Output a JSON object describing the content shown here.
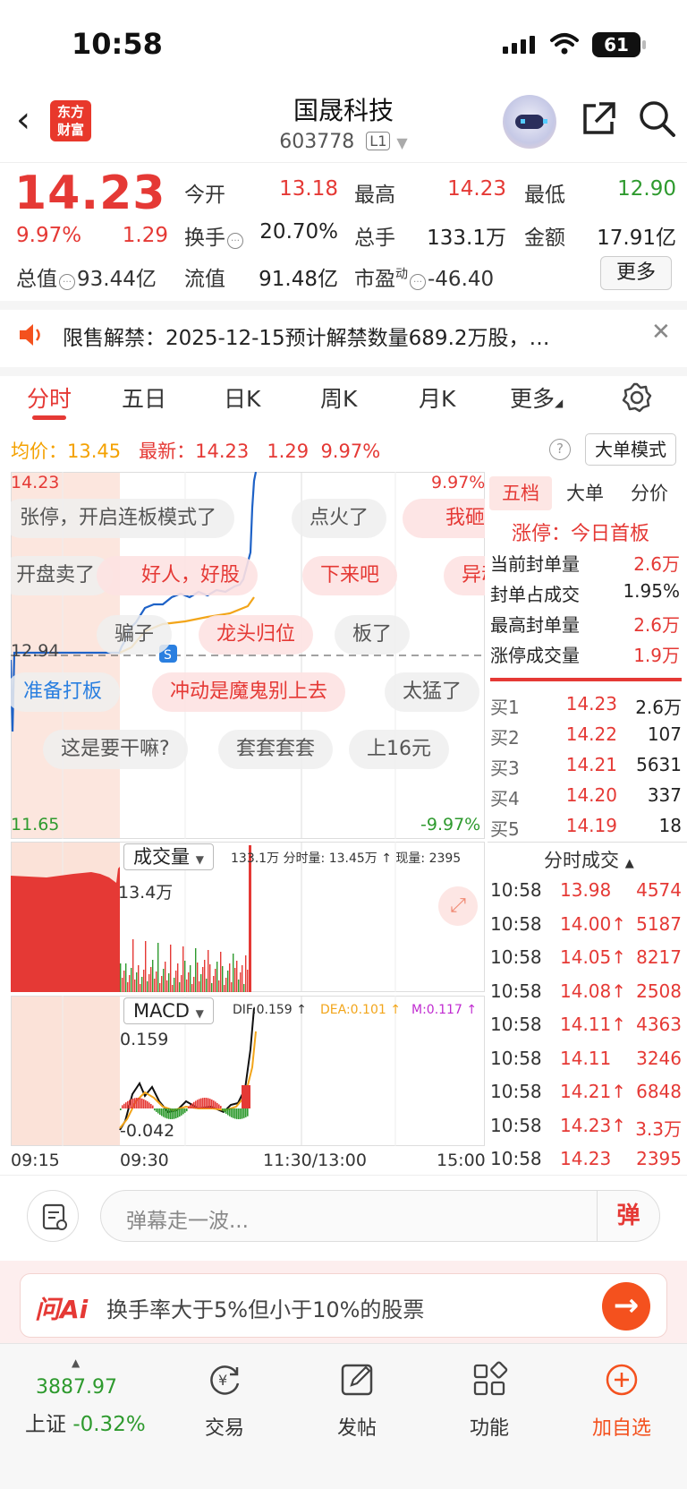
{
  "status_bar": {
    "time": "10:58",
    "battery": "61"
  },
  "header": {
    "name": "国晟科技",
    "code": "603778",
    "level": "L1"
  },
  "quote": {
    "price": "14.23",
    "pct": "9.97%",
    "chg": "1.29",
    "open_label": "今开",
    "open": "13.18",
    "high_label": "最高",
    "high": "14.23",
    "low_label": "最低",
    "low": "12.90",
    "turnover_label": "换手",
    "turnover": "20.70%",
    "volume_label": "总手",
    "volume": "133.1万",
    "amount_label": "金额",
    "amount": "17.91亿",
    "mcap_label": "总值",
    "mcap": "93.44亿",
    "float_label": "流值",
    "float": "91.48亿",
    "pe_label": "市盈",
    "pe_sup": "动",
    "pe": "-46.40",
    "more_label": "更多"
  },
  "notice": {
    "text": "限售解禁：2025-12-15预计解禁数量689.2万股，…"
  },
  "tabs": [
    "分时",
    "五日",
    "日K",
    "周K",
    "月K",
    "更多"
  ],
  "avg_row": {
    "avg_label": "均价：",
    "avg": "13.45",
    "latest_label": "最新：",
    "latest": "14.23",
    "chg": "1.29",
    "pct": "9.97%",
    "big_mode": "大单模式"
  },
  "chart": {
    "y_top": "14.23",
    "y_top_pct": "9.97%",
    "y_mid": "12.94",
    "y_bottom": "11.65",
    "y_bottom_pct": "-9.97%",
    "danmu": [
      "张停，开启连板模式了",
      "点火了",
      "我砸了",
      "开盘卖了",
      "好人，好股",
      "下来吧",
      "异动",
      "骗子",
      "龙头归位",
      "板了",
      "准备打板",
      "冲动是魔鬼别上去",
      "太猛了",
      "这是要干嘛?",
      "套套套套",
      "上16元"
    ],
    "volume_label": "成交量",
    "volume_info": "133.1万 分时量: 13.45万 ↑ 现量: 2395",
    "vol_peak": "13.4万",
    "macd_label": "MACD",
    "dif": "DIF:0.159 ↑",
    "dea": "DEA:0.101 ↑",
    "m": "M:0.117 ↑",
    "macd_top": "0.159",
    "macd_bottom": "-0.042",
    "time_axis": [
      "09:15",
      "09:30",
      "11:30/13:00",
      "15:00"
    ]
  },
  "right_panel": {
    "tabs": [
      "五档",
      "大单",
      "分价"
    ],
    "limit_title": "涨停：今日首板",
    "stats": [
      {
        "label": "当前封单量",
        "value": "2.6万"
      },
      {
        "label": "封单占成交",
        "value": "1.95%"
      },
      {
        "label": "最高封单量",
        "value": "2.6万"
      },
      {
        "label": "涨停成交量",
        "value": "1.9万"
      }
    ],
    "bids": [
      {
        "label": "买1",
        "price": "14.23",
        "vol": "2.6万"
      },
      {
        "label": "买2",
        "price": "14.22",
        "vol": "107"
      },
      {
        "label": "买3",
        "price": "14.21",
        "vol": "5631"
      },
      {
        "label": "买4",
        "price": "14.20",
        "vol": "337"
      },
      {
        "label": "买5",
        "price": "14.19",
        "vol": "18"
      }
    ],
    "ticks_title": "分时成交",
    "ticks": [
      {
        "time": "10:58",
        "price": "13.98",
        "vol": "4574"
      },
      {
        "time": "10:58",
        "price": "14.00↑",
        "vol": "5187"
      },
      {
        "time": "10:58",
        "price": "14.05↑",
        "vol": "8217"
      },
      {
        "time": "10:58",
        "price": "14.08↑",
        "vol": "2508"
      },
      {
        "time": "10:58",
        "price": "14.11↑",
        "vol": "4363"
      },
      {
        "time": "10:58",
        "price": "14.11",
        "vol": "3246"
      },
      {
        "time": "10:58",
        "price": "14.21↑",
        "vol": "6848"
      },
      {
        "time": "10:58",
        "price": "14.23↑",
        "vol": "3.3万"
      },
      {
        "time": "10:58",
        "price": "14.23",
        "vol": "2395"
      }
    ]
  },
  "input_bar": {
    "placeholder": "弹幕走一波...",
    "danmu_btn": "弹"
  },
  "ai_bar": {
    "logo": "问Ai",
    "question": "换手率大于5%但小于10%的股票"
  },
  "bottom_nav": {
    "index_value": "3887.97",
    "index_name": "上证",
    "index_pct": "-0.32%",
    "items": [
      "交易",
      "发帖",
      "功能",
      "加自选"
    ]
  },
  "colors": {
    "up": "#e53935",
    "down": "#2e9a2e",
    "accent": "#f4511e"
  }
}
